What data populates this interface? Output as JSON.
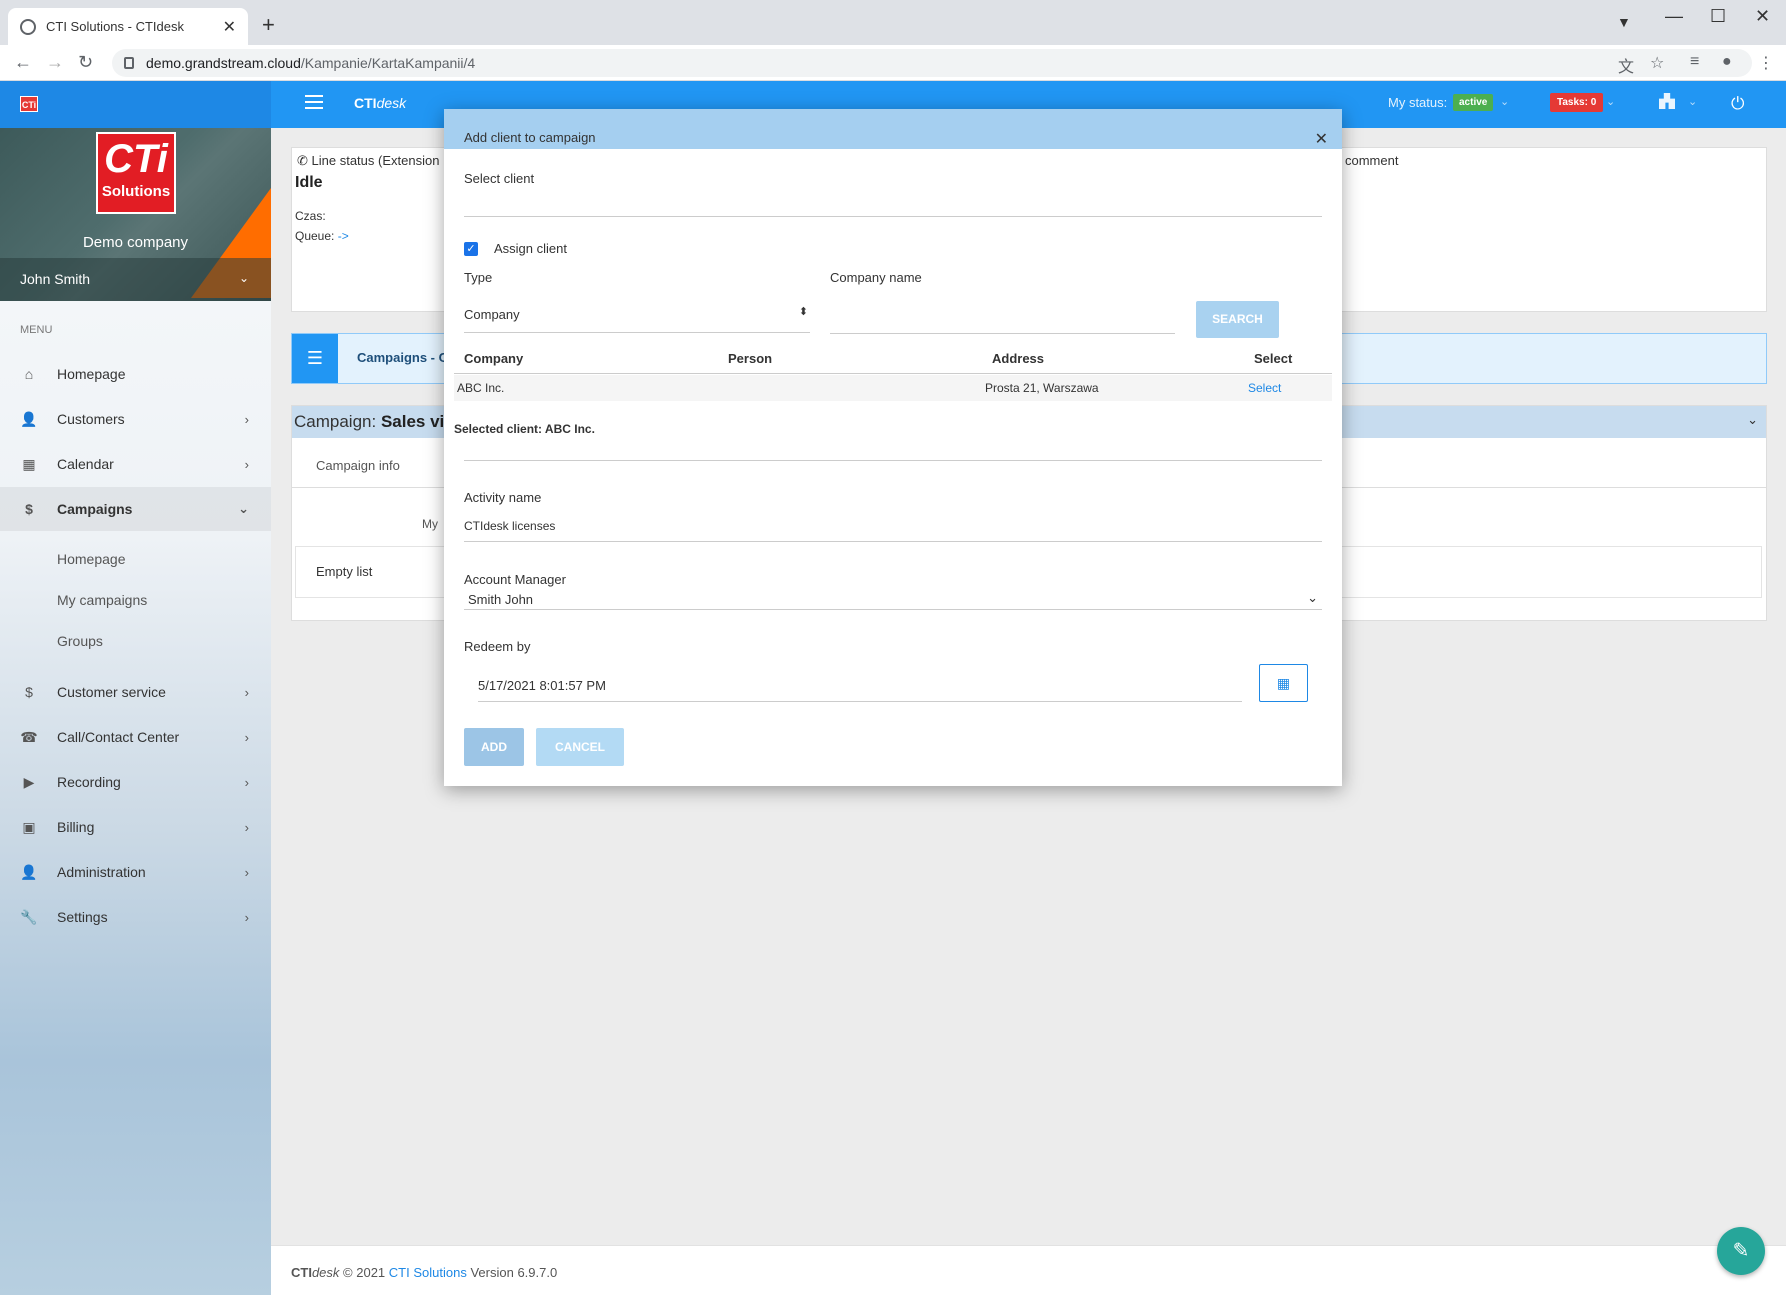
{
  "browser": {
    "tab_title": "CTI Solutions - CTIdesk",
    "url_host": "demo.grandstream.cloud",
    "url_path": "/Kampanie/KartaKampanii/4"
  },
  "app": {
    "title_bold": "CTI",
    "title_italic": "desk",
    "mini_logo": "CTi",
    "my_status_label": "My status:",
    "status_value": "active",
    "tasks_label": "Tasks: 0",
    "colors": {
      "primary": "#2196f3",
      "active": "#4caf50",
      "tasks": "#e53935"
    }
  },
  "sidebar": {
    "logo_big": "CTi",
    "logo_small": "Solutions",
    "company": "Demo company",
    "user": "John Smith",
    "menu_label": "MENU",
    "items": [
      {
        "label": "Homepage",
        "icon": "home-icon"
      },
      {
        "label": "Customers",
        "icon": "person-icon"
      },
      {
        "label": "Calendar",
        "icon": "calendar-icon"
      },
      {
        "label": "Campaigns",
        "icon": "dollar-icon"
      },
      {
        "label": "Customer service",
        "icon": "dollar-icon"
      },
      {
        "label": "Call/Contact Center",
        "icon": "phone-icon"
      },
      {
        "label": "Recording",
        "icon": "play-icon"
      },
      {
        "label": "Billing",
        "icon": "money-icon"
      },
      {
        "label": "Administration",
        "icon": "admin-icon"
      },
      {
        "label": "Settings",
        "icon": "wrench-icon"
      }
    ],
    "sub_items": [
      "Homepage",
      "My campaigns",
      "Groups"
    ]
  },
  "main": {
    "line_status_title": "Line status (Extension",
    "line_status_value": "Idle",
    "czas_label": "Czas:",
    "queue_label": "Queue:",
    "queue_value": "->",
    "comment_label": "comment",
    "breadcrumb": "Campaigns - C",
    "campaign_prefix": "Campaign:",
    "campaign_name": "Sales via",
    "tab_campaign_info": "Campaign info",
    "my_label": "My",
    "empty_list": "Empty list"
  },
  "footer": {
    "brand_bold": "CTI",
    "brand_italic": "desk",
    "copy": "© 2021",
    "company_link": "CTI Solutions",
    "version": "Version 6.9.7.0"
  },
  "modal": {
    "title": "Add client to campaign",
    "select_client_label": "Select client",
    "assign_client_label": "Assign client",
    "assign_checked": true,
    "type_label": "Type",
    "type_value": "Company",
    "company_name_label": "Company name",
    "search_button": "SEARCH",
    "table_headers": [
      "Company",
      "Person",
      "Address",
      "Select"
    ],
    "rows": [
      {
        "company": "ABC Inc.",
        "person": "",
        "address": "Prosta 21, Warszawa",
        "select": "Select"
      }
    ],
    "selected_client": "Selected client: ABC Inc.",
    "activity_name_label": "Activity name",
    "activity_name_value": "CTIdesk licenses",
    "account_manager_label": "Account Manager",
    "account_manager_value": "Smith John",
    "redeem_by_label": "Redeem by",
    "redeem_by_value": "5/17/2021 8:01:57 PM",
    "add_button": "ADD",
    "cancel_button": "CANCEL"
  }
}
